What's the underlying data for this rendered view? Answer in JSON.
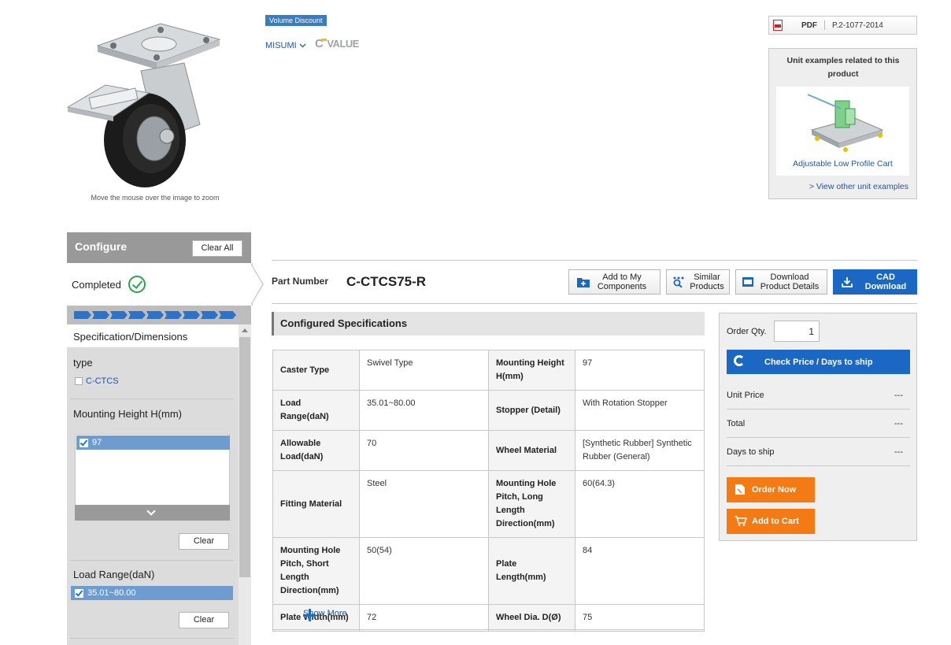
{
  "product": {
    "zoom_hint": "Move the mouse over the image to zoom",
    "badge": "Volume Discount",
    "brand": "MISUMI",
    "cvalue": "VALUE",
    "cvalue_c": "C"
  },
  "pdf": {
    "label": "PDF",
    "code": "P.2-1077-2014"
  },
  "unit_examples": {
    "title": "Unit examples related to this product",
    "card_label": "Adjustable Low Profile Cart",
    "more_link": "> View other unit examples"
  },
  "configure": {
    "title": "Configure",
    "clear_all": "Clear All",
    "completed": "Completed",
    "progress_steps": 9,
    "section": "Specification/Dimensions",
    "filters": {
      "type_title": "type",
      "type_option": "C-CTCS",
      "mounting_title": "Mounting Height H(mm)",
      "mounting_selected": "97",
      "load_title": "Load Range(daN)",
      "load_selected": "35.01~80.00",
      "clear": "Clear"
    }
  },
  "part": {
    "label": "Part Number",
    "value": "C-CTCS75-R",
    "buttons": {
      "add_components": "Add to My Components",
      "similar": "Similar Products",
      "download": "Download Product Details",
      "cad": "CAD Download"
    }
  },
  "specs": {
    "title": "Configured Specifications",
    "rows": [
      [
        {
          "k": "Caster Type",
          "v": "Swivel Type"
        },
        {
          "k": "Mounting Height H(mm)",
          "v": "97"
        }
      ],
      [
        {
          "k": "Load Range(daN)",
          "v": "35.01~80.00"
        },
        {
          "k": "Stopper (Detail)",
          "v": "With Rotation Stopper"
        }
      ],
      [
        {
          "k": "Allowable Load(daN)",
          "v": "70"
        },
        {
          "k": "Wheel Material",
          "v": "[Synthetic Rubber] Synthetic Rubber (General)"
        }
      ],
      [
        {
          "k": "Fitting Material",
          "v": "Steel"
        },
        {
          "k": "Mounting Hole Pitch, Long Length Direction(mm)",
          "v": "60(64.3)"
        }
      ],
      [
        {
          "k": "Mounting Hole Pitch, Short Length Direction(mm)",
          "v": "50(54)"
        },
        {
          "k": "Plate Length(mm)",
          "v": "84"
        }
      ],
      [
        {
          "k": "Plate Width(mm)",
          "v": "72"
        },
        {
          "k": "Wheel Dia. D(Ø)",
          "v": "75"
        }
      ]
    ],
    "show_more": "Show More"
  },
  "order": {
    "qty_label": "Order Qty.",
    "qty_value": "1",
    "check_price": "Check Price / Days to ship",
    "unit_price_label": "Unit Price",
    "unit_price": "---",
    "total_label": "Total",
    "total": "---",
    "days_label": "Days to ship",
    "days": "---",
    "order_now": "Order Now",
    "add_to_cart": "Add to Cart"
  },
  "colors": {
    "accent": "#1a68c4",
    "order": "#f47a14",
    "completed": "#26a54d"
  }
}
